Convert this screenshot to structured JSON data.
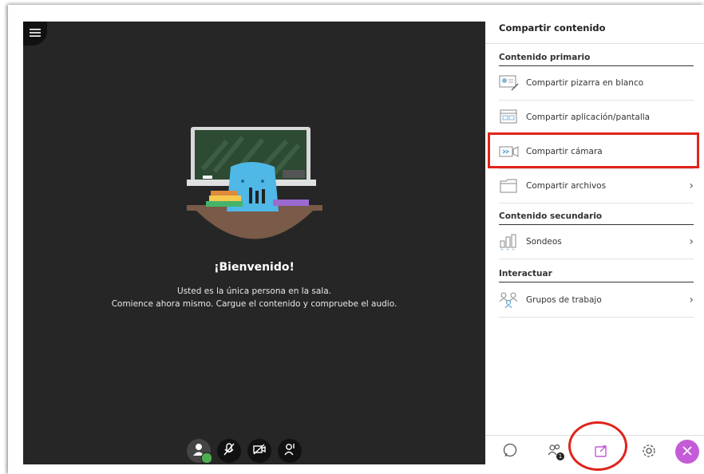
{
  "stage": {
    "welcome_title": "¡Bienvenido!",
    "welcome_line1": "Usted es la única persona en la sala.",
    "welcome_line2": "Comience ahora mismo. Cargue el contenido y compruebe el audio."
  },
  "panel": {
    "title": "Compartir contenido",
    "primary_section": "Contenido primario",
    "secondary_section": "Contenido secundario",
    "interact_section": "Interactuar",
    "items": [
      {
        "label": "Compartir pizarra en blanco",
        "icon": "whiteboard-icon"
      },
      {
        "label": "Compartir aplicación/pantalla",
        "icon": "screen-share-icon"
      },
      {
        "label": "Compartir cámara",
        "icon": "camera-share-icon"
      },
      {
        "label": "Compartir archivos",
        "icon": "folder-icon"
      },
      {
        "label": "Sondeos",
        "icon": "poll-icon"
      },
      {
        "label": "Grupos de trabajo",
        "icon": "breakout-groups-icon"
      }
    ]
  },
  "bottom_bar": {
    "participants_badge": "1"
  },
  "colors": {
    "accent_purple": "#c45bd8",
    "annotation_red": "#e0231c",
    "stage_bg": "#262626"
  }
}
